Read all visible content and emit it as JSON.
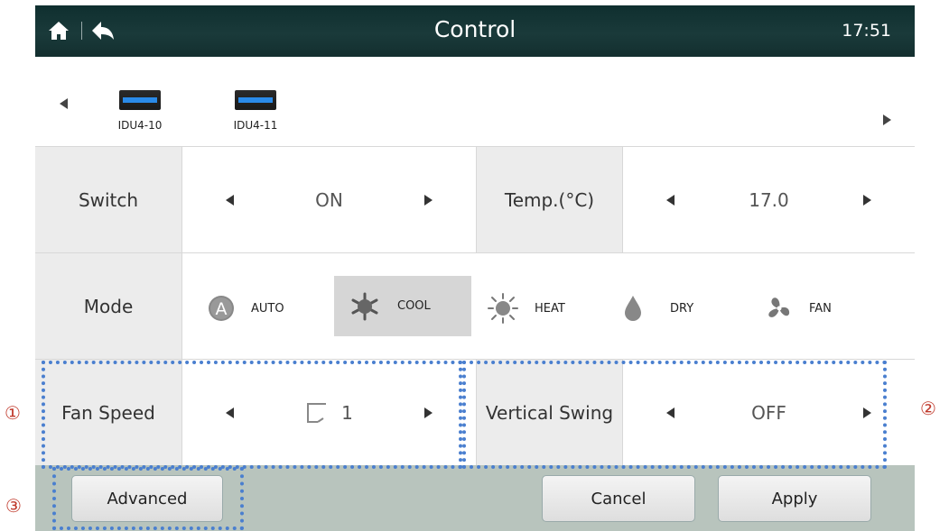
{
  "header": {
    "title": "Control",
    "time": "17:51",
    "home_icon": "home-icon",
    "back_icon": "back-arrow-icon"
  },
  "devices": [
    {
      "name": "IDU4-10"
    },
    {
      "name": "IDU4-11"
    }
  ],
  "rows": {
    "switch": {
      "label": "Switch",
      "value": "ON"
    },
    "temp": {
      "label": "Temp.(°C)",
      "value": "17.0"
    },
    "mode": {
      "label": "Mode",
      "options": [
        "AUTO",
        "COOL",
        "HEAT",
        "DRY",
        "FAN"
      ],
      "selected": "COOL"
    },
    "fan_speed": {
      "label": "Fan Speed",
      "value": "1"
    },
    "vertical_swing": {
      "label": "Vertical Swing",
      "value": "OFF"
    }
  },
  "buttons": {
    "advanced": "Advanced",
    "cancel": "Cancel",
    "apply": "Apply"
  },
  "annotations": {
    "one": "①",
    "two": "②",
    "three": "③"
  },
  "colors": {
    "header": "#1a3a3a",
    "selection": "#d6d6d6",
    "accent_blue": "#2a8ae8",
    "annotation": "#4a7fcf",
    "marker": "#c0392b"
  }
}
